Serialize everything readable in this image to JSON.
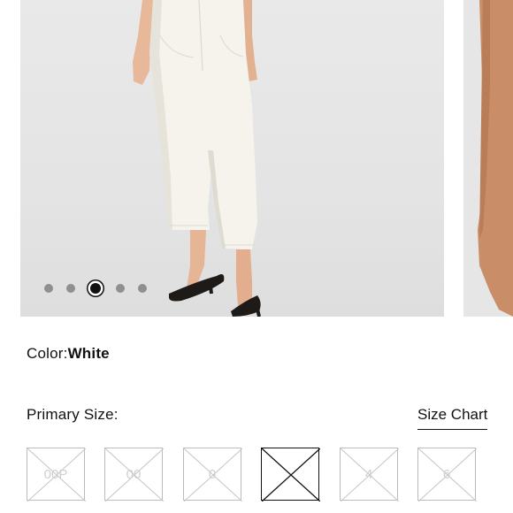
{
  "carousel": {
    "slide_count": 5,
    "active_index": 2
  },
  "color": {
    "label": "Color:",
    "value": "White"
  },
  "size": {
    "label": "Primary Size:",
    "chart_link": "Size Chart",
    "options": [
      {
        "label": "00P",
        "available": false,
        "selected": false
      },
      {
        "label": "00",
        "available": false,
        "selected": false
      },
      {
        "label": "0",
        "available": false,
        "selected": false
      },
      {
        "label": "",
        "available": false,
        "selected": true
      },
      {
        "label": "4",
        "available": false,
        "selected": false
      },
      {
        "label": "6",
        "available": false,
        "selected": false
      }
    ]
  },
  "colors": {
    "accent": "#111111",
    "disabled": "#bcbcbc",
    "photo_bg": "#e6e6e6"
  }
}
